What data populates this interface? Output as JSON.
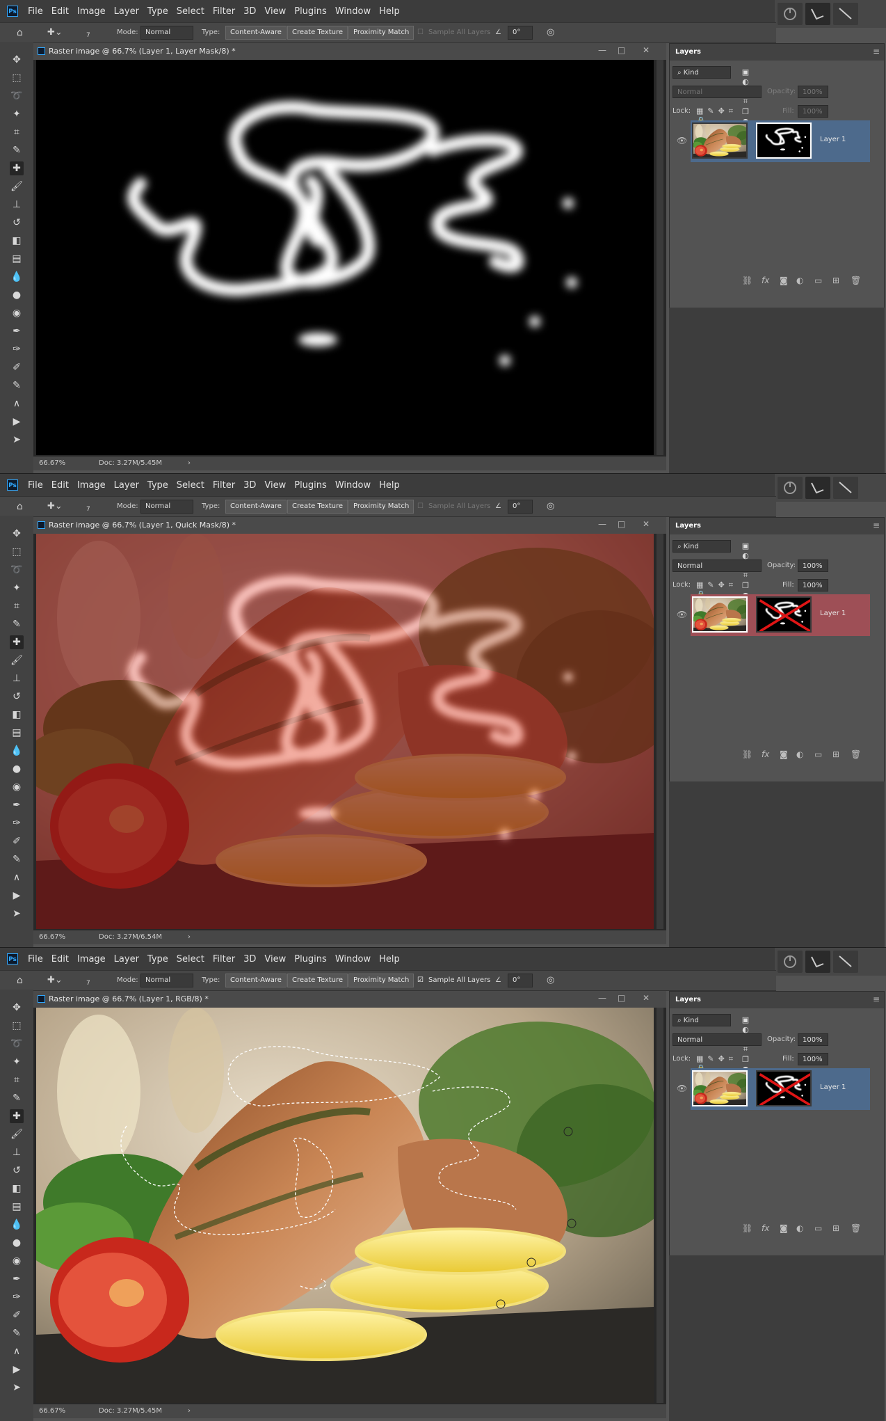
{
  "menu": [
    "File",
    "Edit",
    "Image",
    "Layer",
    "Type",
    "Select",
    "Filter",
    "3D",
    "View",
    "Plugins",
    "Window",
    "Help"
  ],
  "ps_logo": "Ps",
  "options": {
    "brush_size": "7",
    "mode_label": "Mode:",
    "mode_value": "Normal",
    "type_label": "Type:",
    "btn_content_aware": "Content-Aware",
    "btn_create_texture": "Create Texture",
    "btn_proximity": "Proximity Match",
    "sample_all": "Sample All Layers",
    "angle": "0°"
  },
  "layers_panel": {
    "title": "Layers",
    "kind": "Kind",
    "opacity_label": "Opacity:",
    "fill_label": "Fill:",
    "lock_label": "Lock:",
    "pct": "100%",
    "layer_name": "Layer 1"
  },
  "panels": [
    {
      "doc_title": "Raster image @ 66.7% (Layer 1, Layer Mask/8) *",
      "zoom": "66.67%",
      "doc_size": "Doc: 3.27M/5.45M",
      "blend": "Normal",
      "sample_checked": false,
      "canvas": "mask",
      "layer_row_color": "#4d6a8c",
      "mask_disabled": false
    },
    {
      "doc_title": "Raster image @ 66.7% (Layer 1, Quick Mask/8) *",
      "zoom": "66.67%",
      "doc_size": "Doc: 3.27M/6.54M",
      "blend": "Normal",
      "sample_checked": false,
      "canvas": "quickmask",
      "layer_row_color": "#9e4f56",
      "mask_disabled": true
    },
    {
      "doc_title": "Raster image @ 66.7% (Layer 1, RGB/8) *",
      "zoom": "66.67%",
      "doc_size": "Doc: 3.27M/5.45M",
      "blend": "Normal",
      "sample_checked": true,
      "canvas": "photo",
      "layer_row_color": "#4d6a8c",
      "mask_disabled": true
    }
  ]
}
